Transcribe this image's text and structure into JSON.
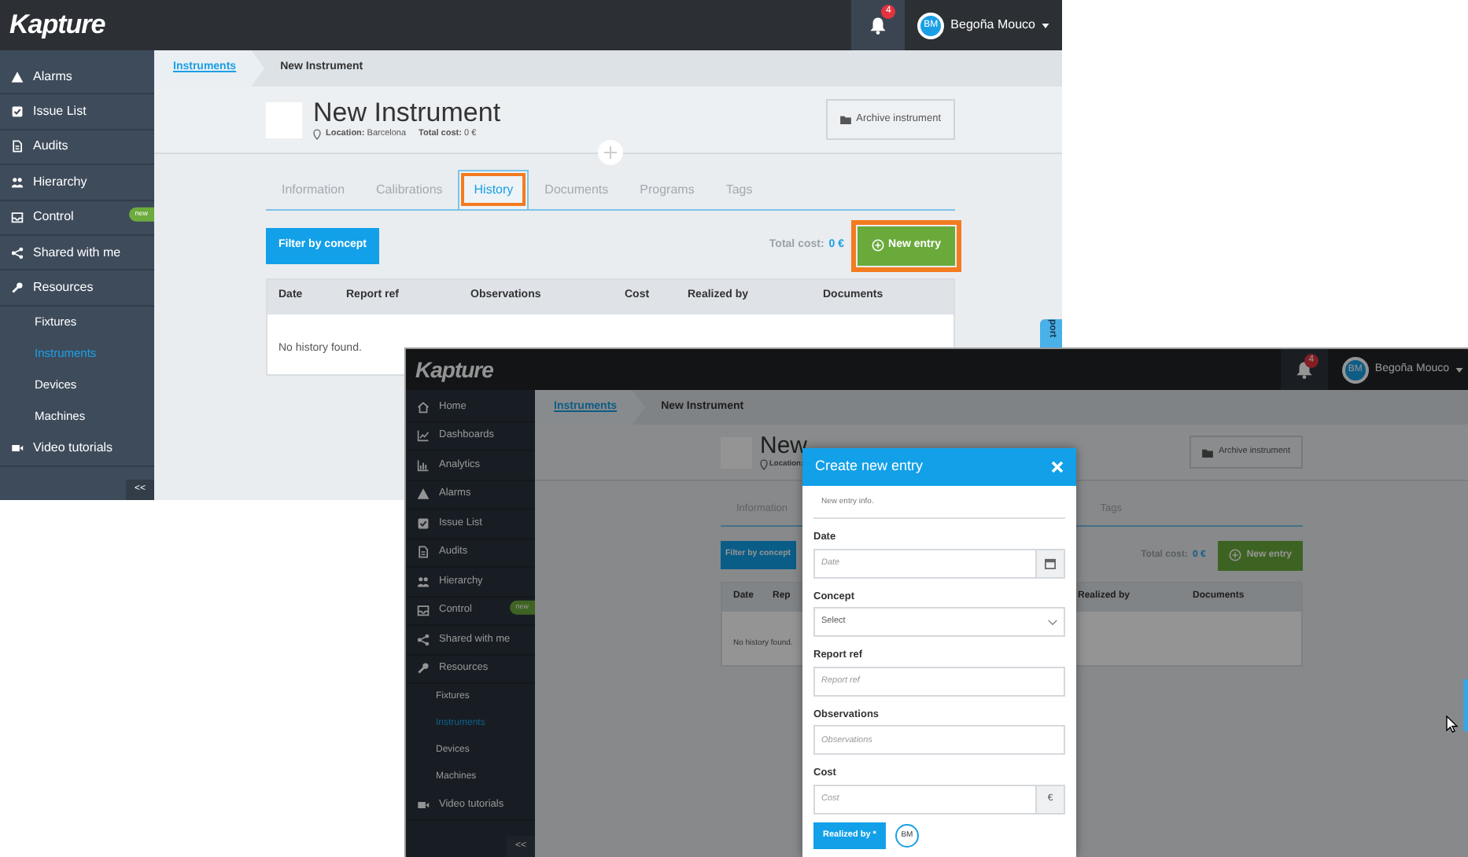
{
  "screenshots": [
    {
      "dimmed": false,
      "logo": "Kapture",
      "notification_count": "4",
      "user": {
        "initials": "BM",
        "name": "Begoña Mouco"
      },
      "sidebar": [
        {
          "label": "Alarms",
          "selected": false
        },
        {
          "label": "Issue List",
          "selected": false
        },
        {
          "label": "Audits",
          "selected": false
        },
        {
          "label": "Hierarchy",
          "selected": false
        },
        {
          "label": "Control",
          "selected": false,
          "badge": "new"
        },
        {
          "label": "Shared with me",
          "selected": false
        },
        {
          "label": "Resources",
          "selected": false,
          "children": [
            {
              "label": "Fixtures",
              "selected": false
            },
            {
              "label": "Instruments",
              "selected": true
            },
            {
              "label": "Devices",
              "selected": false
            },
            {
              "label": "Machines",
              "selected": false
            }
          ]
        },
        {
          "label": "Video tutorials",
          "selected": false
        }
      ],
      "collapse": "<<",
      "breadcrumb": [
        "Instruments",
        "New Instrument"
      ],
      "title": "New Instrument",
      "location_label": "Location:",
      "location": "Barcelona",
      "cost_label": "Total cost:",
      "cost": "0 €",
      "archive_button": "Archive instrument",
      "tabs": [
        {
          "label": "Information",
          "selected": false,
          "highlighted": false
        },
        {
          "label": "Calibrations",
          "selected": false,
          "highlighted": false
        },
        {
          "label": "History",
          "selected": true,
          "highlighted": true
        },
        {
          "label": "Documents",
          "selected": false,
          "highlighted": false
        },
        {
          "label": "Programs",
          "selected": false,
          "highlighted": false
        },
        {
          "label": "Tags",
          "selected": false,
          "highlighted": false
        }
      ],
      "filter_button": "Filter by concept",
      "total_label": "Total cost:",
      "total_value": "0 €",
      "new_entry": {
        "label": "New entry",
        "highlighted": true
      },
      "table": {
        "columns": [
          "Date",
          "Report ref",
          "Observations",
          "Cost",
          "Realized by",
          "Documents"
        ],
        "empty": "No history found."
      },
      "support_tab": "port"
    },
    {
      "dimmed": true,
      "logo": "Kapture",
      "notification_count": "4",
      "user": {
        "initials": "BM",
        "name": "Begoña Mouco"
      },
      "sidebar": [
        {
          "label": "Home",
          "selected": false
        },
        {
          "label": "Dashboards",
          "selected": false
        },
        {
          "label": "Analytics",
          "selected": false
        },
        {
          "label": "Alarms",
          "selected": false
        },
        {
          "label": "Issue List",
          "selected": false
        },
        {
          "label": "Audits",
          "selected": false
        },
        {
          "label": "Hierarchy",
          "selected": false
        },
        {
          "label": "Control",
          "selected": false,
          "badge": "new"
        },
        {
          "label": "Shared with me",
          "selected": false
        },
        {
          "label": "Resources",
          "selected": false,
          "children": [
            {
              "label": "Fixtures",
              "selected": false
            },
            {
              "label": "Instruments",
              "selected": true
            },
            {
              "label": "Devices",
              "selected": false
            },
            {
              "label": "Machines",
              "selected": false
            }
          ]
        },
        {
          "label": "Video tutorials",
          "selected": false
        }
      ],
      "collapse": "<<",
      "breadcrumb": [
        "Instruments",
        "New Instrument"
      ],
      "title": "New",
      "location_label": "Location:",
      "archive_button": "Archive instrument",
      "tabs": [
        {
          "label": "Information",
          "selected": false,
          "highlighted": false
        },
        {
          "label": "Tags",
          "selected": false,
          "highlighted": false
        }
      ],
      "filter_button": "Filter by concept",
      "total_label": "Total cost:",
      "total_value": "0 €",
      "new_entry": {
        "label": "New entry",
        "highlighted": false
      },
      "table": {
        "columns": [
          "Date",
          "Rep",
          "Realized by",
          "Documents"
        ],
        "empty": "No history found."
      },
      "modal": {
        "title": "Create new entry",
        "info": "New entry info.",
        "fields": [
          {
            "kind": "date",
            "label": "Date",
            "placeholder": "Date"
          },
          {
            "kind": "select",
            "label": "Concept",
            "value": "Select"
          },
          {
            "kind": "text",
            "label": "Report ref",
            "placeholder": "Report ref"
          },
          {
            "kind": "text",
            "label": "Observations",
            "placeholder": "Observations"
          },
          {
            "kind": "currency",
            "label": "Cost",
            "placeholder": "Cost",
            "addon": "€"
          }
        ],
        "realized_button": "Realized by *",
        "assignee": "BM"
      }
    }
  ]
}
